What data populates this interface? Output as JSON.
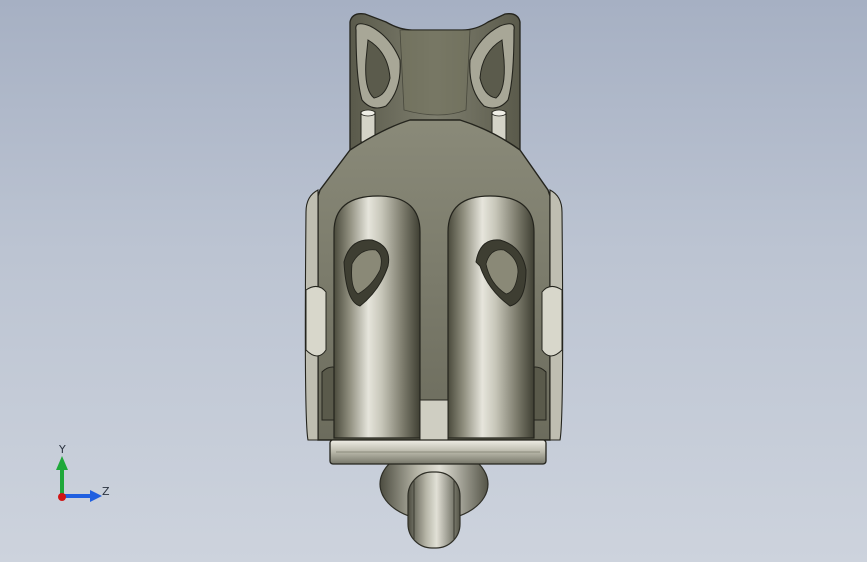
{
  "viewport": {
    "background_top": "#a6b0c3",
    "background_bottom": "#cdd3dd"
  },
  "model": {
    "name": "caster-wheel-bracket-assembly",
    "view": "front"
  },
  "triad": {
    "y_label": "Y",
    "z_label": "Z",
    "colors": {
      "y": "#1fa83a",
      "z": "#1f5fe0",
      "origin": "#d01515"
    }
  }
}
